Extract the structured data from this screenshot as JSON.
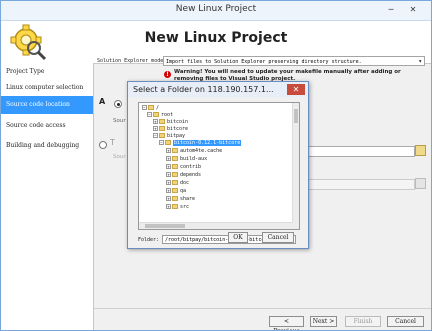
{
  "window": {
    "title": "New Linux Project",
    "header_title": "New Linux Project",
    "controls": {
      "minimize": "─",
      "close": "✕"
    }
  },
  "sidebar": {
    "items": [
      {
        "label": "Project Type"
      },
      {
        "label": "Linux computer selection"
      },
      {
        "label": "Source code location",
        "selected": true
      },
      {
        "label": "Source code access"
      },
      {
        "label": "Building and debugging"
      }
    ]
  },
  "main": {
    "explorer_mode_label": "Solution Explorer mode",
    "explorer_mode_value": "Import files to Solution Explorer preserving directory structure.",
    "warning": "Warning! You will need to update your makefile manually after adding or removing files to Visual Studio project.",
    "option1_letter": "A",
    "source_label_1": "Sour",
    "option2_letter": "T",
    "source_label_2": "Sour"
  },
  "footer": {
    "previous": "< Previous",
    "next": "Next >",
    "finish": "Finish",
    "cancel": "Cancel"
  },
  "dialog": {
    "title": "Select a Folder on 118.190.157.1...",
    "close": "✕",
    "tree": [
      {
        "label": "/",
        "depth": 0,
        "expanded": true
      },
      {
        "label": "root",
        "depth": 1,
        "expanded": true
      },
      {
        "label": "bitcoin",
        "depth": 2,
        "expanded": false
      },
      {
        "label": "bitcore",
        "depth": 2,
        "expanded": false
      },
      {
        "label": "bitpay",
        "depth": 2,
        "expanded": true
      },
      {
        "label": "bitcoin-0.12.1-bitcore",
        "depth": 3,
        "expanded": true,
        "selected": true
      },
      {
        "label": "autom4te.cache",
        "depth": 4,
        "expanded": false
      },
      {
        "label": "build-aux",
        "depth": 4,
        "expanded": false
      },
      {
        "label": "contrib",
        "depth": 4,
        "expanded": false
      },
      {
        "label": "depends",
        "depth": 4,
        "expanded": false
      },
      {
        "label": "doc",
        "depth": 4,
        "expanded": false
      },
      {
        "label": "qa",
        "depth": 4,
        "expanded": false
      },
      {
        "label": "share",
        "depth": 4,
        "expanded": false
      },
      {
        "label": "src",
        "depth": 4,
        "expanded": false
      }
    ],
    "folder_label": "Folder:",
    "folder_value": "/root/bitpay/bitcoin-0.12.1-bitcore",
    "ok": "OK",
    "cancel": "Cancel"
  }
}
